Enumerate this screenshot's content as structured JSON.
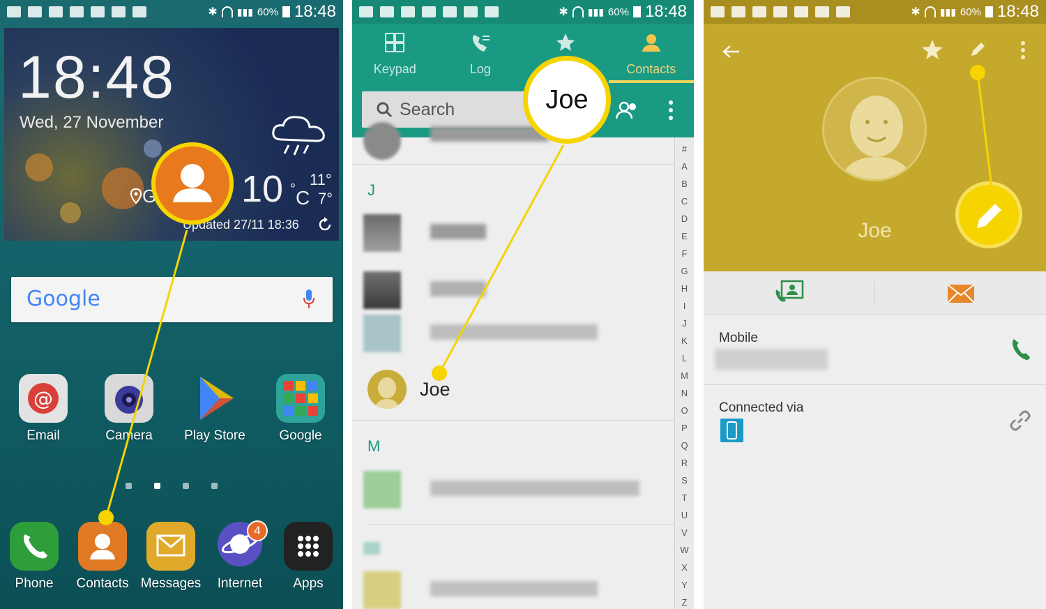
{
  "status_bar": {
    "battery": "60%",
    "time": "18:48"
  },
  "home": {
    "clock": "18:48",
    "date": "Wed, 27 November",
    "weather": {
      "temp": "10",
      "unit_deg": "°",
      "unit": "C",
      "hi": "11°",
      "lo": "7°",
      "location": "G",
      "updated": "Updated 27/11 18:36"
    },
    "search_logo": "Google",
    "apps_row1": [
      {
        "label": "Email"
      },
      {
        "label": "Camera"
      },
      {
        "label": "Play Store"
      },
      {
        "label": "Google"
      }
    ],
    "dock": [
      {
        "label": "Phone"
      },
      {
        "label": "Contacts"
      },
      {
        "label": "Messages"
      },
      {
        "label": "Internet",
        "badge": "4"
      },
      {
        "label": "Apps"
      }
    ]
  },
  "contacts_list": {
    "tabs": [
      {
        "label": "Keypad"
      },
      {
        "label": "Log"
      },
      {
        "label": ""
      },
      {
        "label": "Contacts"
      }
    ],
    "search_placeholder": "Search",
    "sections": [
      "J",
      "M"
    ],
    "contact": {
      "name": "Joe"
    },
    "callout_text": "Joe",
    "alphabet": [
      "#",
      "A",
      "B",
      "C",
      "D",
      "E",
      "F",
      "G",
      "H",
      "I",
      "J",
      "K",
      "L",
      "M",
      "N",
      "O",
      "P",
      "Q",
      "R",
      "S",
      "T",
      "U",
      "V",
      "W",
      "X",
      "Y",
      "Z"
    ]
  },
  "contact_detail": {
    "name": "Joe",
    "mobile_label": "Mobile",
    "connected_label": "Connected via"
  },
  "colors": {
    "accent_yellow": "#f5d400",
    "contacts_teal": "#1b9a83",
    "detail_header": "#c4a92c"
  }
}
